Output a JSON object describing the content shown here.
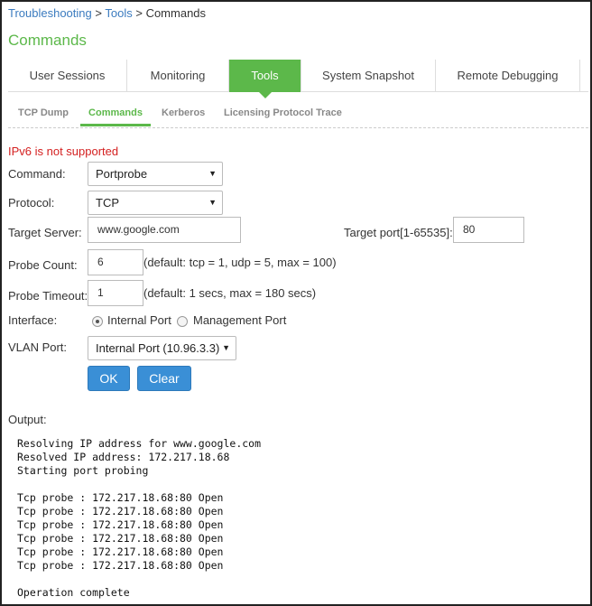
{
  "breadcrumb": {
    "items": [
      "Troubleshooting",
      "Tools",
      "Commands"
    ],
    "separator": ">"
  },
  "page_title": "Commands",
  "tabs": [
    {
      "label": "User Sessions",
      "active": false
    },
    {
      "label": "Monitoring",
      "active": false
    },
    {
      "label": "Tools",
      "active": true
    },
    {
      "label": "System Snapshot",
      "active": false
    },
    {
      "label": "Remote Debugging",
      "active": false
    }
  ],
  "subtabs": [
    {
      "label": "TCP Dump",
      "active": false
    },
    {
      "label": "Commands",
      "active": true
    },
    {
      "label": "Kerberos",
      "active": false
    },
    {
      "label": "Licensing Protocol Trace",
      "active": false
    }
  ],
  "warning": "IPv6 is not supported",
  "form": {
    "command": {
      "label": "Command:",
      "value": "Portprobe"
    },
    "protocol": {
      "label": "Protocol:",
      "value": "TCP"
    },
    "target_server": {
      "label": "Target Server:",
      "value": "www.google.com"
    },
    "target_port": {
      "label": "Target port[1-65535]:",
      "value": "80"
    },
    "probe_count": {
      "label": "Probe Count:",
      "value": "6",
      "hint": "(default: tcp = 1, udp = 5, max = 100)"
    },
    "probe_timeout": {
      "label": "Probe Timeout:",
      "value": "1",
      "hint": "(default: 1 secs, max = 180 secs)"
    },
    "interface": {
      "label": "Interface:",
      "options": [
        {
          "label": "Internal Port",
          "checked": true
        },
        {
          "label": "Management Port",
          "checked": false
        }
      ]
    },
    "vlan_port": {
      "label": "VLAN Port:",
      "value": "Internal Port (10.96.3.3)"
    }
  },
  "buttons": {
    "ok": "OK",
    "clear": "Clear"
  },
  "output": {
    "label": "Output:",
    "lines": [
      "Resolving IP address for www.google.com",
      "Resolved IP address: 172.217.18.68",
      "Starting port probing",
      "",
      "Tcp probe : 172.217.18.68:80 Open",
      "Tcp probe : 172.217.18.68:80 Open",
      "Tcp probe : 172.217.18.68:80 Open",
      "Tcp probe : 172.217.18.68:80 Open",
      "Tcp probe : 172.217.18.68:80 Open",
      "Tcp probe : 172.217.18.68:80 Open",
      "",
      "Operation complete"
    ]
  },
  "colors": {
    "accent_green": "#5cb84a",
    "link_blue": "#3b7bbf",
    "button_blue": "#3a8fd6",
    "warning_red": "#d42020"
  },
  "icons": {
    "dropdown": "chevron-down-icon",
    "radio": "radio-icon"
  }
}
